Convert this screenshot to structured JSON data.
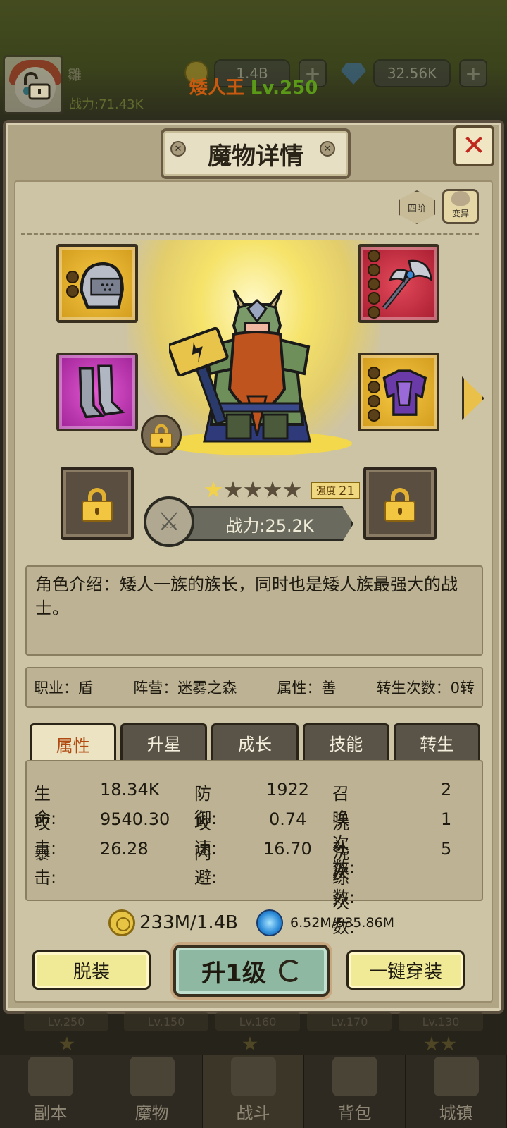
{
  "topbar": {
    "player_name": "雛",
    "power": "战力:71.43K",
    "gold": "1.4B",
    "gems": "32.56K",
    "plus_label": "+"
  },
  "panel": {
    "title": "魔物详情",
    "close_label": "✕",
    "monster_name": "矮人王",
    "monster_level": "Lv.250",
    "tier": "四阶",
    "mutate_label": "变异",
    "stars_total": 5,
    "stars_filled": 1,
    "strength_label": "强度",
    "strength_value": "21",
    "power": "战力:25.2K",
    "description": "角色介绍：矮人一族的族长，同时也是矮人族最强大的战士。",
    "info": {
      "job": "职业：盾",
      "camp": "阵营：迷雾之森",
      "attr": "属性：善",
      "rebirth": "转生次数：0转"
    },
    "tabs": [
      {
        "label": "属性",
        "active": true
      },
      {
        "label": "升星",
        "active": false
      },
      {
        "label": "成长",
        "active": false
      },
      {
        "label": "技能",
        "active": false
      },
      {
        "label": "转生",
        "active": false
      }
    ],
    "stats": [
      {
        "k": "生命:",
        "v": "18.34K"
      },
      {
        "k": "防御:",
        "v": "1922"
      },
      {
        "k": "召唤次数:",
        "v": "2"
      },
      {
        "k": "攻击:",
        "v": "9540.30"
      },
      {
        "k": "攻速:",
        "v": "0.74"
      },
      {
        "k": "洗礼次数:",
        "v": "1"
      },
      {
        "k": "暴击:",
        "v": "26.28"
      },
      {
        "k": "闪避:",
        "v": "16.70"
      },
      {
        "k": "洗练次数:",
        "v": "5"
      }
    ],
    "gold_cost": "233M/1.4B",
    "orb_cost": "6.52M/535.86M",
    "buttons": {
      "unequip": "脱装",
      "levelup": "升1级",
      "equip_all": "一键穿装"
    }
  },
  "team_levels": [
    "Lv.250",
    "Lv.150",
    "Lv.160",
    "Lv.170",
    "Lv.130"
  ],
  "nav": [
    {
      "label": "副本"
    },
    {
      "label": "魔物"
    },
    {
      "label": "战斗",
      "active": true
    },
    {
      "label": "背包"
    },
    {
      "label": "城镇"
    }
  ],
  "colors": {
    "name": "#c85a10",
    "level": "#5a9a18",
    "active_tab_text": "#b04a10"
  }
}
